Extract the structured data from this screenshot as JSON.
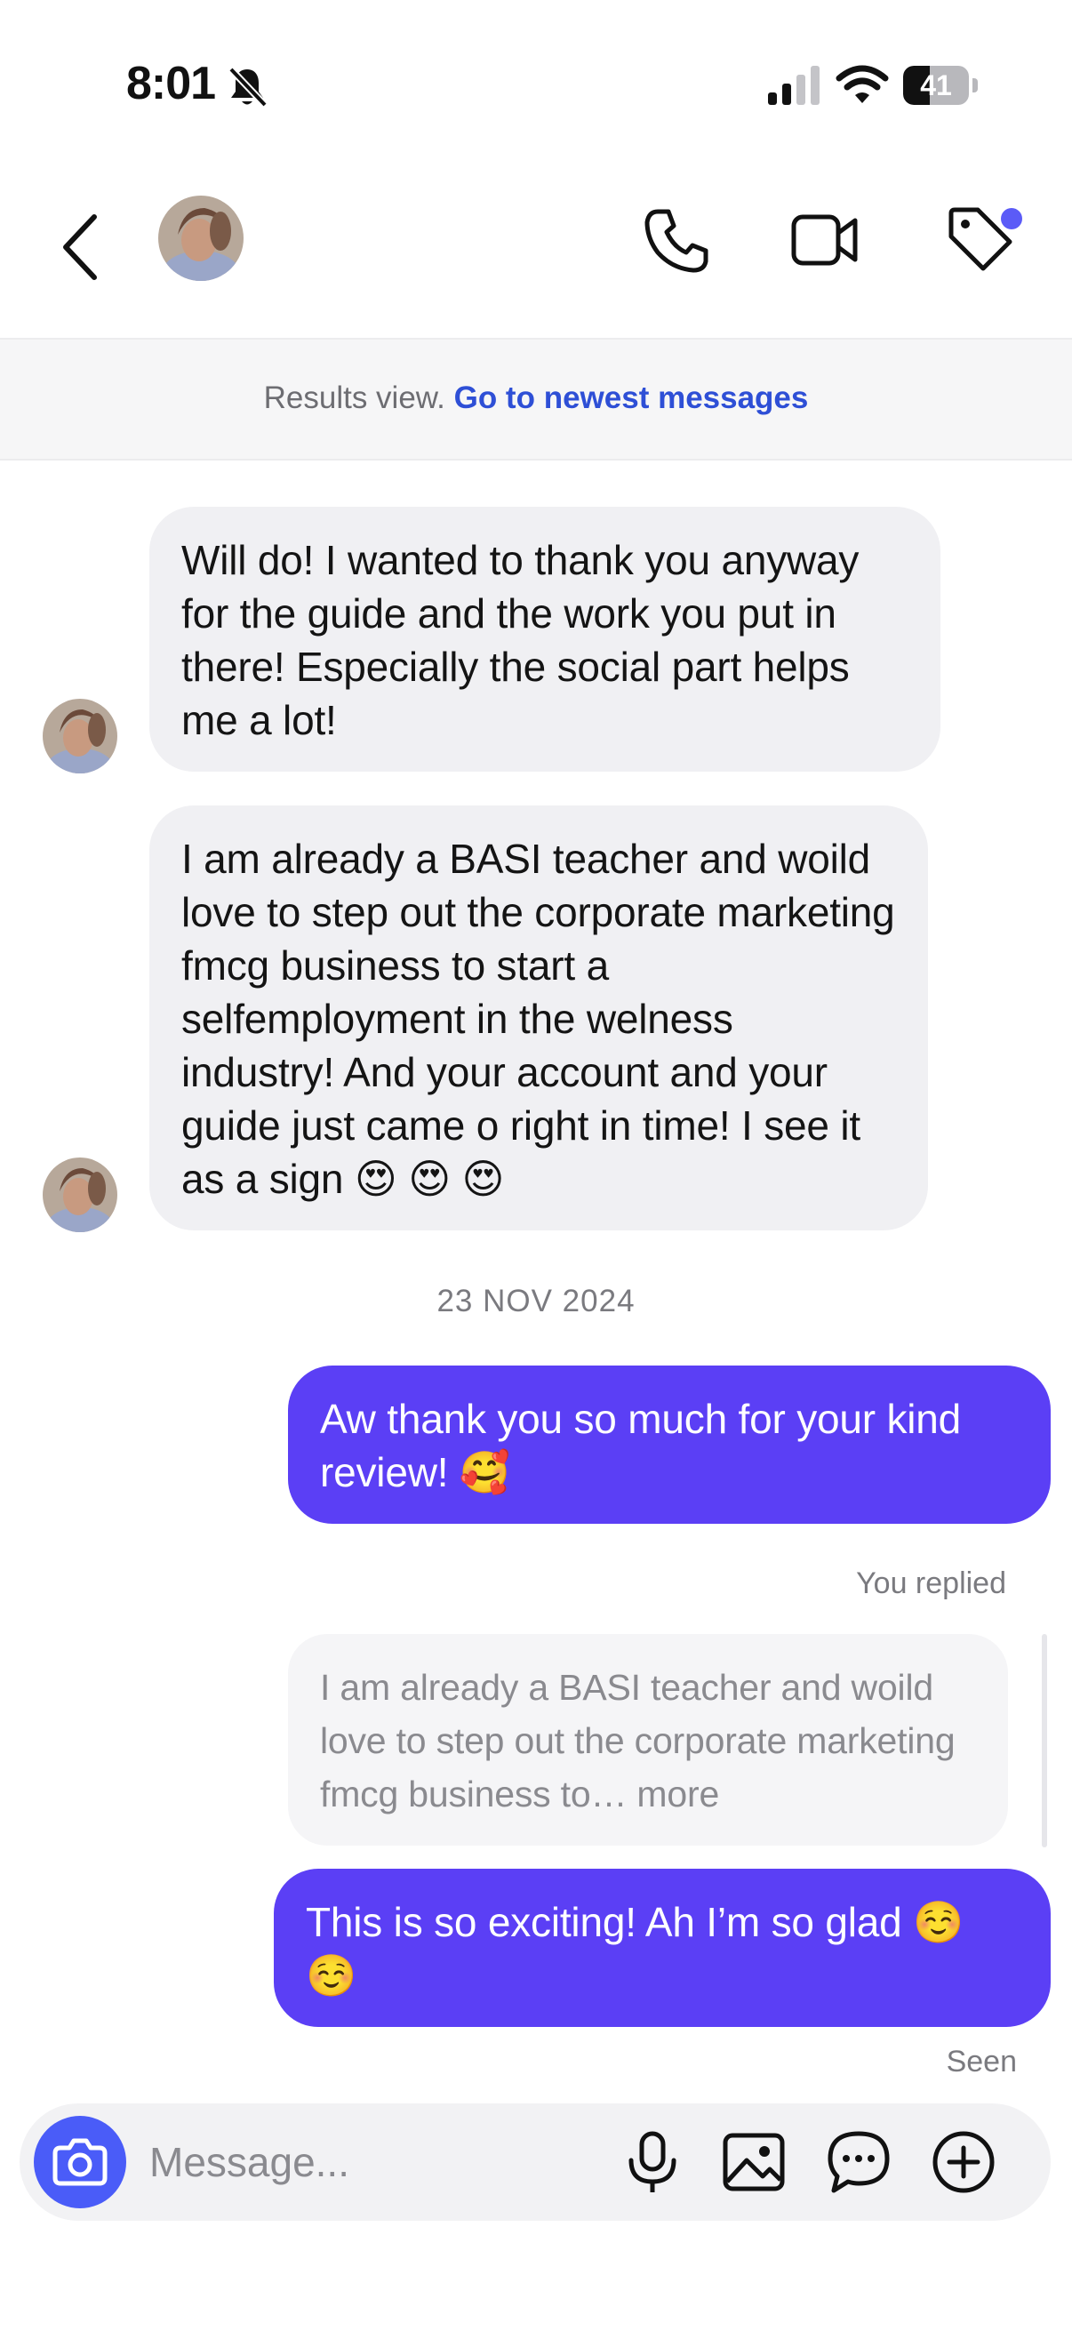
{
  "status_bar": {
    "time": "8:01",
    "battery": "41",
    "battery_level": 0.41
  },
  "header": {
    "icons": [
      "back-icon",
      "phone-icon",
      "video-icon",
      "tag-icon"
    ],
    "accent": "#5b5bf7"
  },
  "banner": {
    "text": "Results view.",
    "link": "Go to newest messages"
  },
  "messages": {
    "incoming": [
      {
        "text": "Will do! I wanted to thank you anyway for the guide and the work you put in there! Especially the social part helps me a lot!"
      },
      {
        "text": "I am already a BASI teacher and woild love to step out the corporate marketing fmcg business to start a selfemployment in the welness industry! And your account and your guide just came o right in time! I see it as a sign 😍 😍 😍"
      }
    ],
    "date_separator": "23 NOV 2024",
    "outgoing_1": {
      "text": "Aw thank you so much for your kind review! 🥰"
    },
    "reply_label": "You replied",
    "quoted": {
      "text": "I am already a BASI teacher and woild love to step out the corporate marketing fmcg business to… more"
    },
    "outgoing_2": {
      "text": "This is so exciting! Ah I’m so glad ☺️ ☺️"
    },
    "seen": "Seen"
  },
  "composer": {
    "placeholder": "Message...",
    "icons": [
      "camera-icon",
      "microphone-icon",
      "image-icon",
      "sticker-icon",
      "plus-icon"
    ]
  },
  "colors": {
    "outgoing_bubble": "#5b3ff5",
    "incoming_bubble": "#f0f0f3",
    "link": "#2e4fd6",
    "camera_button": "#4a5cf8"
  }
}
